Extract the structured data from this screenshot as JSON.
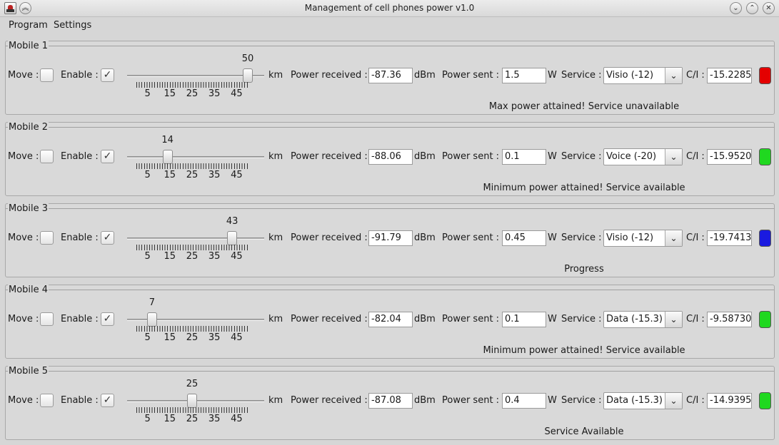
{
  "window": {
    "title": "Management of cell phones power v1.0"
  },
  "menu": {
    "program": "Program",
    "settings": "Settings"
  },
  "labels": {
    "move": "Move :",
    "enable": "Enable :",
    "km": "km",
    "power_received": "Power received :",
    "dbm": "dBm",
    "power_sent": "Power sent :",
    "w": "W",
    "service": "Service :",
    "ci": "C/I :",
    "check_mark": "✓"
  },
  "slider": {
    "min": 0,
    "max": 50,
    "tick_labels": [
      "5",
      "15",
      "25",
      "35",
      "45"
    ]
  },
  "mobiles": [
    {
      "title": "Mobile 1",
      "enabled": true,
      "move": false,
      "distance": "50",
      "distance_value": 50,
      "power_received": "-87.36",
      "power_sent": "1.5",
      "service": "Visio (-12)",
      "ci": "-15.2285",
      "led_color": "#e40000",
      "status": "Max power attained! Service unavailable"
    },
    {
      "title": "Mobile 2",
      "enabled": true,
      "move": false,
      "distance": "14",
      "distance_value": 14,
      "power_received": "-88.06",
      "power_sent": "0.1",
      "service": "Voice (-20)",
      "ci": "-15.9520",
      "led_color": "#20d820",
      "status": "Minimum power attained! Service available"
    },
    {
      "title": "Mobile 3",
      "enabled": true,
      "move": false,
      "distance": "43",
      "distance_value": 43,
      "power_received": "-91.79",
      "power_sent": "0.45",
      "service": "Visio (-12)",
      "ci": "-19.7413",
      "led_color": "#1a1ae0",
      "status": "Progress"
    },
    {
      "title": "Mobile 4",
      "enabled": true,
      "move": false,
      "distance": "7",
      "distance_value": 7,
      "power_received": "-82.04",
      "power_sent": "0.1",
      "service": "Data (-15.3)",
      "ci": "-9.58730",
      "led_color": "#20d820",
      "status": "Minimum power attained! Service available"
    },
    {
      "title": "Mobile 5",
      "enabled": true,
      "move": false,
      "distance": "25",
      "distance_value": 25,
      "power_received": "-87.08",
      "power_sent": "0.4",
      "service": "Data (-15.3)",
      "ci": "-14.9395",
      "led_color": "#20d820",
      "status": "Service Available"
    }
  ]
}
